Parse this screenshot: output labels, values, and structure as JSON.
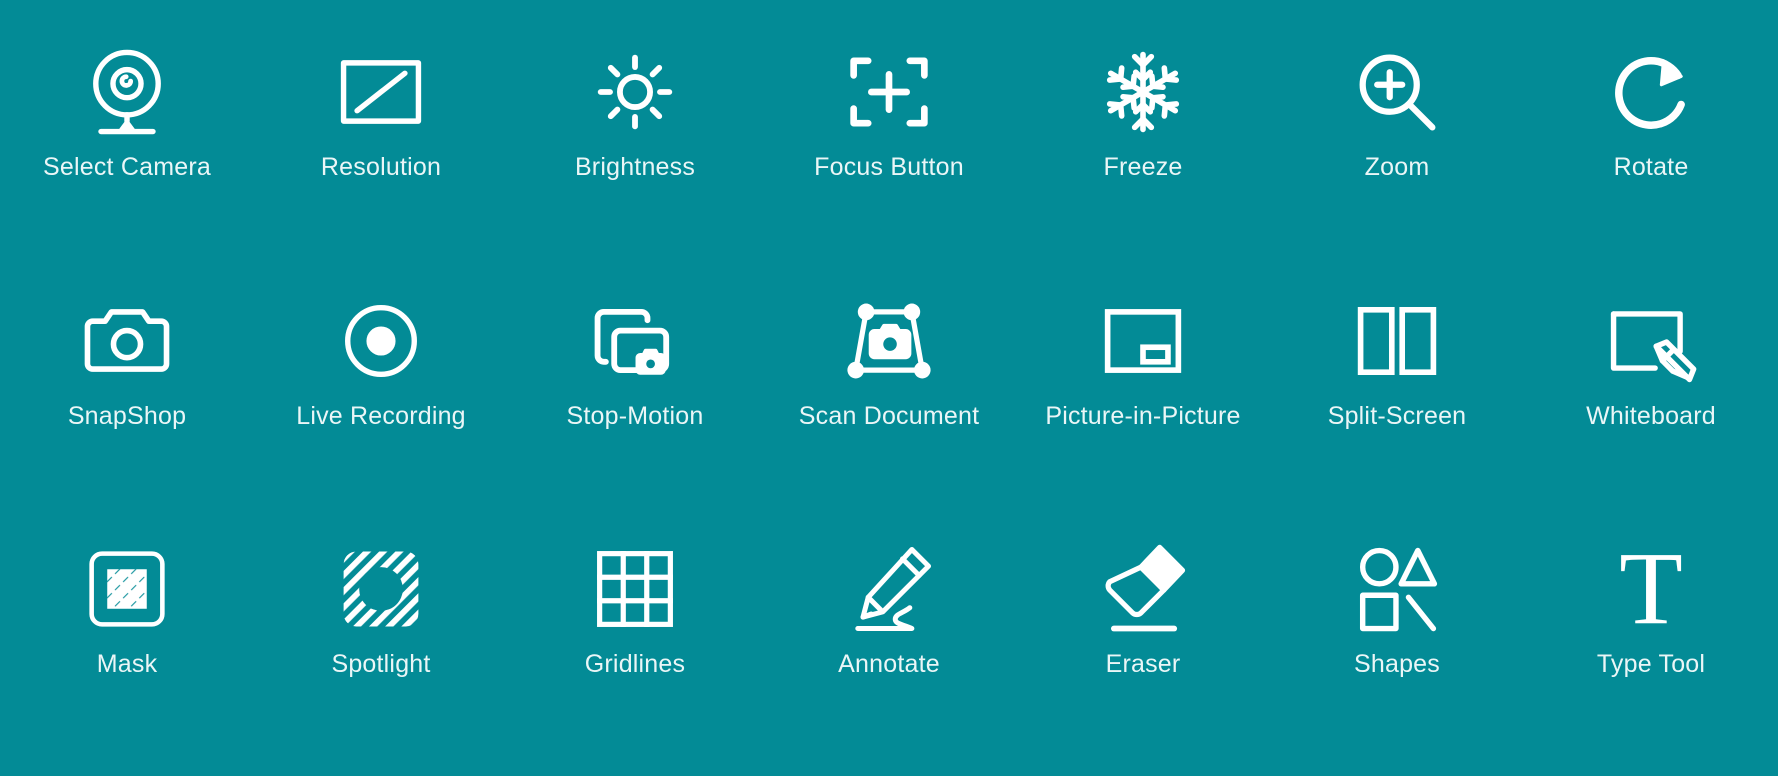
{
  "page": {
    "background_color": "#038b96",
    "icon_color": "#ffffff",
    "label_color": "#eaf6f7",
    "columns": 7,
    "rows": 3
  },
  "features": [
    {
      "label": "Select Camera",
      "icon": "webcam-icon"
    },
    {
      "label": "Resolution",
      "icon": "resolution-icon"
    },
    {
      "label": "Brightness",
      "icon": "brightness-sun-icon"
    },
    {
      "label": "Focus Button",
      "icon": "focus-frame-plus-icon"
    },
    {
      "label": "Freeze",
      "icon": "snowflake-icon"
    },
    {
      "label": "Zoom",
      "icon": "magnifier-plus-icon"
    },
    {
      "label": "Rotate",
      "icon": "rotate-clockwise-icon"
    },
    {
      "label": "SnapShop",
      "icon": "camera-icon"
    },
    {
      "label": "Live Recording",
      "icon": "record-dot-icon"
    },
    {
      "label": "Stop-Motion",
      "icon": "stacked-frames-camera-icon"
    },
    {
      "label": "Scan Document",
      "icon": "scan-trapezoid-camera-icon"
    },
    {
      "label": "Picture-in-Picture",
      "icon": "pip-icon"
    },
    {
      "label": "Split-Screen",
      "icon": "split-screen-icon"
    },
    {
      "label": "Whiteboard",
      "icon": "whiteboard-pencil-icon"
    },
    {
      "label": "Mask",
      "icon": "mask-hatched-square-icon"
    },
    {
      "label": "Spotlight",
      "icon": "spotlight-hatched-circle-icon"
    },
    {
      "label": "Gridlines",
      "icon": "grid-3x3-icon"
    },
    {
      "label": "Annotate",
      "icon": "pencil-squiggle-icon"
    },
    {
      "label": "Eraser",
      "icon": "eraser-icon"
    },
    {
      "label": "Shapes",
      "icon": "shapes-icon"
    },
    {
      "label": "Type Tool",
      "icon": "type-tool-t-icon",
      "glyph": "T"
    }
  ]
}
